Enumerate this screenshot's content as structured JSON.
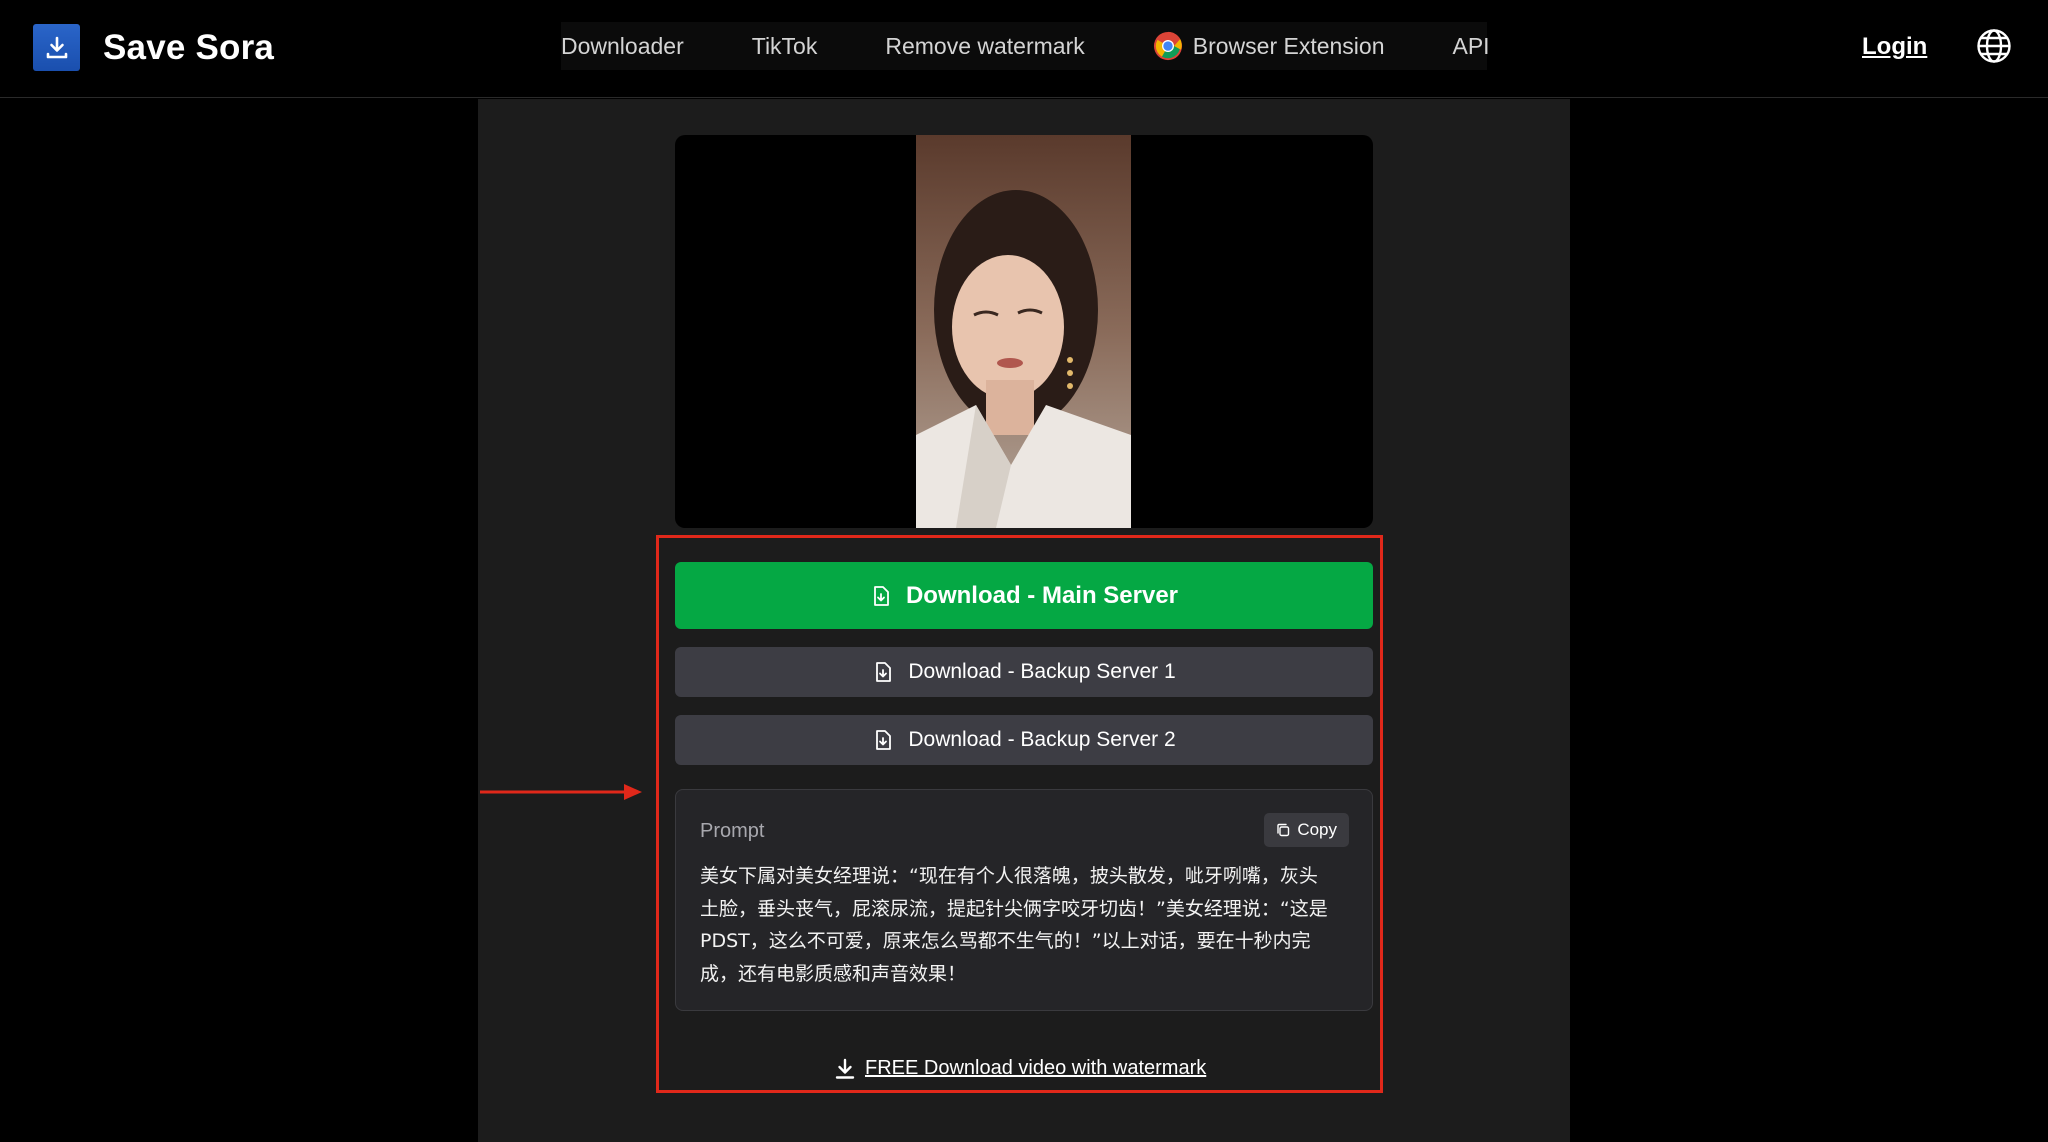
{
  "header": {
    "brand": "Save Sora",
    "nav": [
      {
        "label": "Downloader"
      },
      {
        "label": "TikTok"
      },
      {
        "label": "Remove watermark"
      },
      {
        "label": "Browser Extension"
      },
      {
        "label": "API"
      }
    ],
    "login_label": "Login"
  },
  "actions": {
    "main_label": "Download - Main Server",
    "backup1_label": "Download - Backup Server 1",
    "backup2_label": "Download - Backup Server 2",
    "free_label": "FREE Download video with watermark"
  },
  "prompt": {
    "label": "Prompt",
    "copy_label": "Copy",
    "text": "美女下属对美女经理说：“现在有个人很落魄，披头散发，呲牙咧嘴，灰头土脸，垂头丧气，屁滚尿流，提起针尖俩字咬牙切齿！”美女经理说：“这是PDST，这么不可爱，原来怎么骂都不生气的！”以上对话，要在十秒内完成，还有电影质感和声音效果！"
  },
  "colors": {
    "primary_button": "#05a844",
    "secondary_button": "#3d3d44",
    "highlight": "#e0281a",
    "logo": "#1f57b8"
  },
  "icons": [
    "download-icon",
    "chrome-icon",
    "globe-icon",
    "file-download-icon",
    "copy-icon",
    "arrow-icon"
  ]
}
